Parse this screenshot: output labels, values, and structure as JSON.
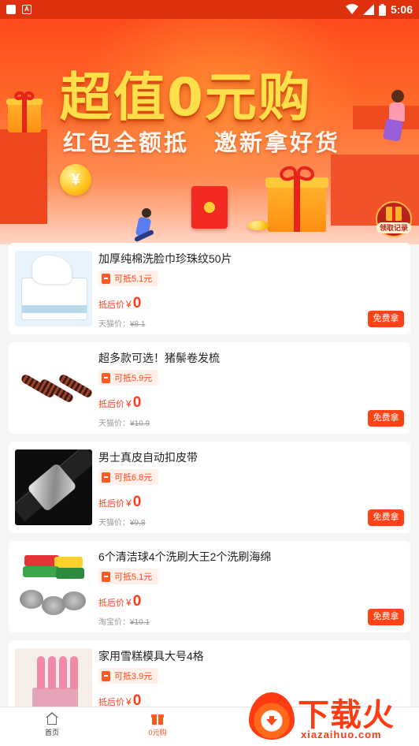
{
  "status_bar": {
    "time": "5:06",
    "left_icons": [
      "app-notification-icon",
      "a-notification-icon"
    ],
    "right_icons": [
      "wifi-icon",
      "signal-icon",
      "battery-icon"
    ]
  },
  "banner": {
    "headline": "超值0元购",
    "subline": "红包全额抵　邀新拿好货",
    "records_label": "领取记录"
  },
  "products": [
    {
      "title": "加厚纯棉洗脸巾珍珠纹50片",
      "deduct": "可抵5.1元",
      "after_label": "抵后价",
      "currency": "¥",
      "price": "0",
      "platform": "天猫价：",
      "original": "¥8.1",
      "button": "免费拿",
      "thumb": "tissue"
    },
    {
      "title": "超多款可选！猪鬃卷发梳",
      "deduct": "可抵5.9元",
      "after_label": "抵后价",
      "currency": "¥",
      "price": "0",
      "platform": "天猫价：",
      "original": "¥10.9",
      "button": "免费拿",
      "thumb": "comb"
    },
    {
      "title": "男士真皮自动扣皮带",
      "deduct": "可抵6.8元",
      "after_label": "抵后价",
      "currency": "¥",
      "price": "0",
      "platform": "天猫价：",
      "original": "¥9.8",
      "button": "免费拿",
      "thumb": "belt"
    },
    {
      "title": "6个清洁球4个洗刷大王2个洗刷海绵",
      "deduct": "可抵5.1元",
      "after_label": "抵后价",
      "currency": "¥",
      "price": "0",
      "platform": "淘宝价：",
      "original": "¥10.1",
      "button": "免费拿",
      "thumb": "sponge"
    },
    {
      "title": "家用雪糕模具大号4格",
      "deduct": "可抵3.9元",
      "after_label": "抵后价",
      "currency": "¥",
      "price": "0",
      "platform": "",
      "original": "",
      "button": "",
      "thumb": "mold"
    }
  ],
  "bottom_nav": [
    {
      "label": "首页",
      "icon": "home-icon",
      "active": false
    },
    {
      "label": "0元购",
      "icon": "gift-icon",
      "active": true
    }
  ],
  "watermark": {
    "text": "下载火",
    "url": "xiazaihuo.com"
  },
  "colors": {
    "primary": "#ff4316",
    "status_bar": "#e0310e",
    "price": "#ff3b1a",
    "headline": "#ffe04a"
  }
}
